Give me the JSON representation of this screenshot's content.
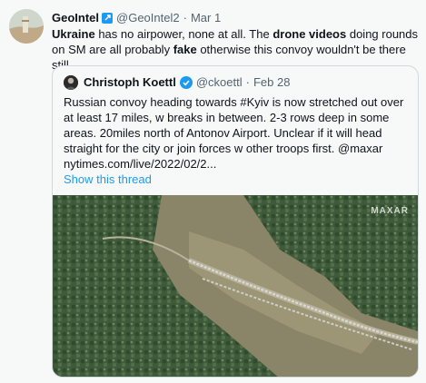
{
  "tweet": {
    "author": {
      "name": "GeoIntel",
      "handle": "@GeoIntel2",
      "date": "Mar 1"
    },
    "text_parts": [
      {
        "t": "Ukraine",
        "b": true
      },
      {
        "t": " has no airpower, none at all. The ",
        "b": false
      },
      {
        "t": "drone videos",
        "b": true
      },
      {
        "t": " doing rounds on SM are all probably ",
        "b": false
      },
      {
        "t": "fake",
        "b": true
      },
      {
        "t": " otherwise this convoy wouldn't be there still.",
        "b": false
      }
    ]
  },
  "quote": {
    "author": {
      "name": "Christoph Koettl",
      "handle": "@ckoettl",
      "date": "Feb 28"
    },
    "text": "Russian convoy heading towards #Kyiv is now stretched out over at least 17 miles, w breaks in between. 2-3 rows deep in some areas. 20miles north of Antonov Airport. Unclear if it will head straight for the city or join forces w other troops first. @maxar nytimes.com/live/2022/02/2...",
    "show_thread": "Show this thread",
    "image_watermark": "MAXAR"
  },
  "colors": {
    "link": "#1d9bf0",
    "verified": "#1d9bf0",
    "secondary": "#536471"
  }
}
